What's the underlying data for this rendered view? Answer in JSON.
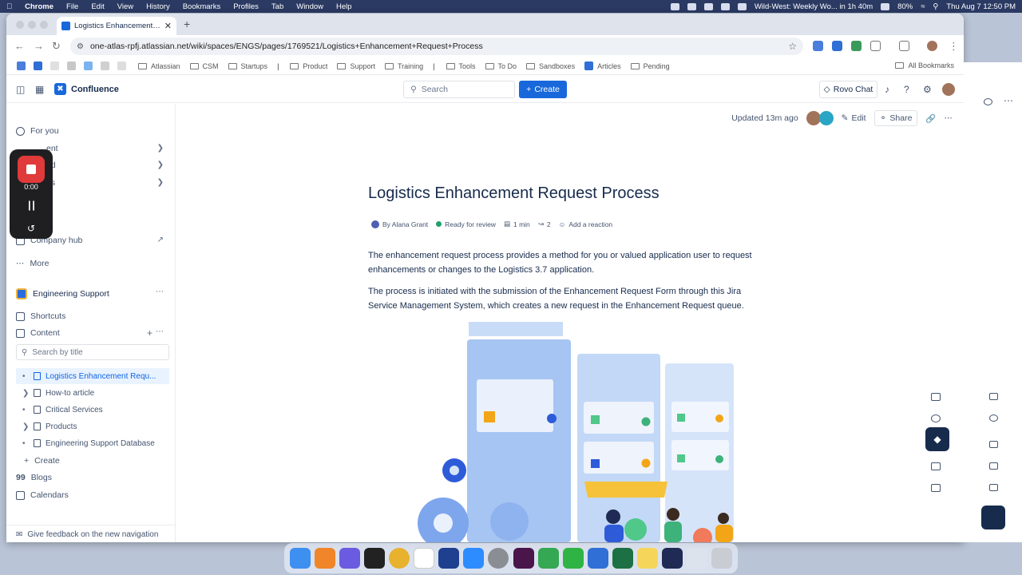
{
  "menubar": {
    "app": "Chrome",
    "items": [
      "File",
      "Edit",
      "View",
      "History",
      "Bookmarks",
      "Profiles",
      "Tab",
      "Window",
      "Help"
    ],
    "meeting": "Wild-West: Weekly Wo... in 1h 40m",
    "battery": "80%",
    "datetime": "Thu Aug 7  12:50 PM"
  },
  "browser": {
    "tab_title": "Logistics Enhancement Requ...",
    "url": "one-atlas-rpfj.atlassian.net/wiki/spaces/ENGS/pages/1769521/Logistics+Enhancement+Request+Process",
    "bookmarks": [
      "Atlassian",
      "CSM",
      "Startups",
      "Product",
      "Support",
      "Training",
      "Tools",
      "To Do",
      "Sandboxes",
      "Articles",
      "Pending"
    ],
    "all_bookmarks": "All Bookmarks"
  },
  "header": {
    "product": "Confluence",
    "search_placeholder": "Search",
    "create": "Create",
    "rovo_chat": "Rovo Chat"
  },
  "sidebar": {
    "for_you": "For you",
    "recent_partial": "ent",
    "starred_partial": "ed",
    "spaces_partial": "es",
    "apps_partial": "s",
    "company_hub": "Company hub",
    "more": "More",
    "space_name": "Engineering Support",
    "shortcuts": "Shortcuts",
    "content": "Content",
    "search_by_title": "Search by title",
    "tree": [
      {
        "label": "Logistics Enhancement Requ...",
        "active": true
      },
      {
        "label": "How-to article",
        "active": false
      },
      {
        "label": "Critical Services",
        "active": false
      },
      {
        "label": "Products",
        "active": false
      },
      {
        "label": "Engineering Support Database",
        "active": false
      }
    ],
    "create": "Create",
    "blogs": "Blogs",
    "calendars": "Calendars",
    "feedback": "Give feedback on the new navigation"
  },
  "recorder": {
    "time": "0:00"
  },
  "page": {
    "updated": "Updated 13m ago",
    "edit": "Edit",
    "share": "Share",
    "title": "Logistics Enhancement Request Process",
    "author": "By Alana Grant",
    "status": "Ready for review",
    "read_time": "1 min",
    "contributors": "2",
    "add_reaction": "Add a reaction",
    "paragraph1": "The enhancement request process provides a method for you or valued application user to request enhancements or changes to the Logistics 3.7 application.",
    "paragraph2": "The process is initiated with the submission of the Enhancement Request Form through this Jira Service Management System, which creates a new request in the Enhancement Request queue."
  },
  "colors": {
    "brand": "#1868db",
    "status_green": "#22a06b",
    "rec_red": "#e03a3a"
  }
}
